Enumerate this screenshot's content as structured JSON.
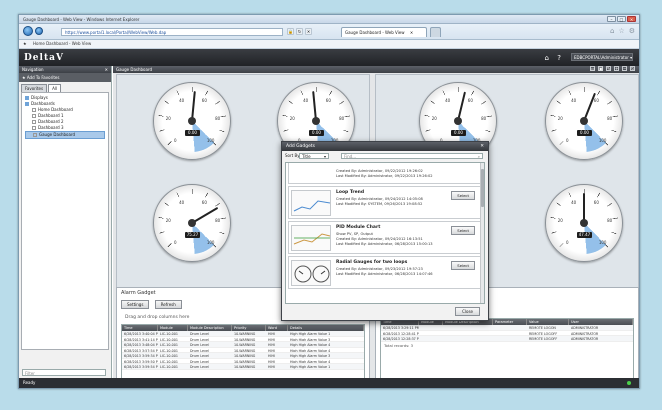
{
  "browser": {
    "title": "Gauge Dashboard - Web View - Windows Internet Explorer",
    "address": "https://www.portal1.local/Portal/WebView/Web.dap",
    "tab_label": "Gauge Dashboard - Web View",
    "tab_close": "✕",
    "favorites_item": "Home Dashboard - Web View"
  },
  "app": {
    "logo": "DeltaV",
    "user": "EDBCPORTAL\\Administrator ▾"
  },
  "navigation": {
    "header": "Navigation",
    "close": "✕",
    "add_favorite": "Add To Favorites",
    "tabs": [
      "Favorites",
      "All"
    ],
    "tree": [
      {
        "label": "Displays",
        "indent": 0
      },
      {
        "label": "Dashboards",
        "indent": 0
      },
      {
        "label": "Home Dashboard",
        "indent": 1
      },
      {
        "label": "Dashboard 1",
        "indent": 1
      },
      {
        "label": "Dashboard 2",
        "indent": 1
      },
      {
        "label": "Dashboard 3",
        "indent": 1
      },
      {
        "label": "Gauge Dashboard",
        "indent": 1
      }
    ],
    "filter_placeholder": "Filter"
  },
  "main": {
    "header": "Gauge Dashboard",
    "gauge_labels": [
      "0",
      "20",
      "40",
      "60",
      "80",
      "100"
    ],
    "gauges": [
      {
        "readout": "0.00",
        "value": 0.52
      },
      {
        "readout": "0.00",
        "value": 0.48
      },
      {
        "readout": "0.00",
        "value": 0.55
      },
      {
        "readout": "0.00",
        "value": 0.58
      },
      {
        "readout": "75.27",
        "value": 0.72
      },
      {
        "readout": "47.47",
        "value": 0.5
      }
    ]
  },
  "alarm_gadget": {
    "title": "Alarm Gadget",
    "buttons": [
      "Settings",
      "Refresh"
    ],
    "drag_hint": "Drag and drop columns here",
    "columns": [
      "Time",
      "Module",
      "Module Description",
      "Priority",
      "Word",
      "Details"
    ],
    "rows": [
      [
        "6/28/2013 3:40:04 PM",
        "LIC-10-001",
        "Drum Level",
        "10-WARNING",
        "HIHI",
        "High High Alarm Value 1"
      ],
      [
        "6/28/2013 3:41:14 PM",
        "LIC-10-001",
        "Drum Level",
        "10-WARNING",
        "HIHI",
        "High High Alarm Value 3"
      ],
      [
        "6/28/2013 3:48:04 PM",
        "LIC-10-001",
        "Drum Level",
        "10-WARNING",
        "HIHI",
        "High High Alarm Value 4"
      ],
      [
        "6/28/2013 3:57:54 PM",
        "LIC-10-001",
        "Drum Level",
        "10-WARNING",
        "HIHI",
        "High High Alarm Value 4"
      ],
      [
        "6/28/2013 3:59:34 PM",
        "LIC-10-001",
        "Drum Level",
        "10-WARNING",
        "HIHI",
        "High High Alarm Value 3"
      ],
      [
        "6/28/2013 3:59:50 PM",
        "LIC-10-001",
        "Drum Level",
        "10-WARNING",
        "HIHI",
        "High High Alarm Value 4"
      ],
      [
        "6/28/2013 3:59:54 PM",
        "LIC-10-001",
        "Drum Level",
        "10-WARNING",
        "HIHI",
        "High High Alarm Value 1"
      ]
    ]
  },
  "event_grid": {
    "columns": [
      "Time",
      "Module",
      "Module Description",
      "Parameter",
      "Value",
      "User"
    ],
    "rows": [
      [
        "6/28/2013 3:29:11 PM",
        "",
        "",
        "",
        "REMOTE LOGON",
        "ADMINISTRATOR"
      ],
      [
        "6/28/2013 12:28:41 PM",
        "",
        "",
        "",
        "REMOTE LOGOFF",
        "ADMINISTRATOR"
      ],
      [
        "6/28/2013 12:28:37 PM",
        "",
        "",
        "",
        "REMOTE LOGOFF",
        "ADMINISTRATOR"
      ]
    ],
    "total": "Total records: 3"
  },
  "dialog": {
    "title": "Add Gadgets",
    "close": "✕",
    "sort_label": "Sort By:",
    "sort_value": "Title",
    "search_placeholder": "Find...",
    "select_label": "Select",
    "close_button": "Close",
    "items": [
      {
        "name": "",
        "meta": [
          "Created By: Administrator, 09/22/2012 19:26:02",
          "Last Modified By: Administrator, 09/22/2013 19:26:02"
        ]
      },
      {
        "name": "Loop Trend",
        "meta": [
          "Created By: Administrator, 09/24/2012 14:05:08",
          "Last Modified By: SYSTEM, 09/26/2013 19:08:52"
        ]
      },
      {
        "name": "PID Module Chart",
        "meta": [
          "Show PV, SP, Output",
          "Created By: Administrator, 09/24/2012 16:13:51",
          "Last Modified By: Administrator, 06/28/2013 15:00:13"
        ]
      },
      {
        "name": "Radial Gauges for two loops",
        "meta": [
          "Created By: Administrator, 09/23/2012 19:57:23",
          "Last Modified By: Administrator, 06/28/2013 14:07:46"
        ]
      }
    ]
  },
  "status": {
    "text": "Ready"
  }
}
